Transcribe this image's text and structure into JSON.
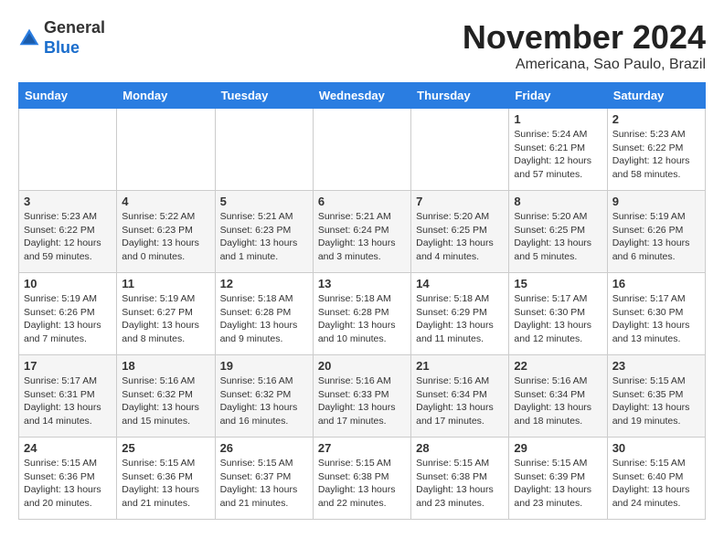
{
  "header": {
    "logo_general": "General",
    "logo_blue": "Blue",
    "month_title": "November 2024",
    "subtitle": "Americana, Sao Paulo, Brazil"
  },
  "weekdays": [
    "Sunday",
    "Monday",
    "Tuesday",
    "Wednesday",
    "Thursday",
    "Friday",
    "Saturday"
  ],
  "weeks": [
    [
      {
        "day": "",
        "info": ""
      },
      {
        "day": "",
        "info": ""
      },
      {
        "day": "",
        "info": ""
      },
      {
        "day": "",
        "info": ""
      },
      {
        "day": "",
        "info": ""
      },
      {
        "day": "1",
        "info": "Sunrise: 5:24 AM\nSunset: 6:21 PM\nDaylight: 12 hours\nand 57 minutes."
      },
      {
        "day": "2",
        "info": "Sunrise: 5:23 AM\nSunset: 6:22 PM\nDaylight: 12 hours\nand 58 minutes."
      }
    ],
    [
      {
        "day": "3",
        "info": "Sunrise: 5:23 AM\nSunset: 6:22 PM\nDaylight: 12 hours\nand 59 minutes."
      },
      {
        "day": "4",
        "info": "Sunrise: 5:22 AM\nSunset: 6:23 PM\nDaylight: 13 hours\nand 0 minutes."
      },
      {
        "day": "5",
        "info": "Sunrise: 5:21 AM\nSunset: 6:23 PM\nDaylight: 13 hours\nand 1 minute."
      },
      {
        "day": "6",
        "info": "Sunrise: 5:21 AM\nSunset: 6:24 PM\nDaylight: 13 hours\nand 3 minutes."
      },
      {
        "day": "7",
        "info": "Sunrise: 5:20 AM\nSunset: 6:25 PM\nDaylight: 13 hours\nand 4 minutes."
      },
      {
        "day": "8",
        "info": "Sunrise: 5:20 AM\nSunset: 6:25 PM\nDaylight: 13 hours\nand 5 minutes."
      },
      {
        "day": "9",
        "info": "Sunrise: 5:19 AM\nSunset: 6:26 PM\nDaylight: 13 hours\nand 6 minutes."
      }
    ],
    [
      {
        "day": "10",
        "info": "Sunrise: 5:19 AM\nSunset: 6:26 PM\nDaylight: 13 hours\nand 7 minutes."
      },
      {
        "day": "11",
        "info": "Sunrise: 5:19 AM\nSunset: 6:27 PM\nDaylight: 13 hours\nand 8 minutes."
      },
      {
        "day": "12",
        "info": "Sunrise: 5:18 AM\nSunset: 6:28 PM\nDaylight: 13 hours\nand 9 minutes."
      },
      {
        "day": "13",
        "info": "Sunrise: 5:18 AM\nSunset: 6:28 PM\nDaylight: 13 hours\nand 10 minutes."
      },
      {
        "day": "14",
        "info": "Sunrise: 5:18 AM\nSunset: 6:29 PM\nDaylight: 13 hours\nand 11 minutes."
      },
      {
        "day": "15",
        "info": "Sunrise: 5:17 AM\nSunset: 6:30 PM\nDaylight: 13 hours\nand 12 minutes."
      },
      {
        "day": "16",
        "info": "Sunrise: 5:17 AM\nSunset: 6:30 PM\nDaylight: 13 hours\nand 13 minutes."
      }
    ],
    [
      {
        "day": "17",
        "info": "Sunrise: 5:17 AM\nSunset: 6:31 PM\nDaylight: 13 hours\nand 14 minutes."
      },
      {
        "day": "18",
        "info": "Sunrise: 5:16 AM\nSunset: 6:32 PM\nDaylight: 13 hours\nand 15 minutes."
      },
      {
        "day": "19",
        "info": "Sunrise: 5:16 AM\nSunset: 6:32 PM\nDaylight: 13 hours\nand 16 minutes."
      },
      {
        "day": "20",
        "info": "Sunrise: 5:16 AM\nSunset: 6:33 PM\nDaylight: 13 hours\nand 17 minutes."
      },
      {
        "day": "21",
        "info": "Sunrise: 5:16 AM\nSunset: 6:34 PM\nDaylight: 13 hours\nand 17 minutes."
      },
      {
        "day": "22",
        "info": "Sunrise: 5:16 AM\nSunset: 6:34 PM\nDaylight: 13 hours\nand 18 minutes."
      },
      {
        "day": "23",
        "info": "Sunrise: 5:15 AM\nSunset: 6:35 PM\nDaylight: 13 hours\nand 19 minutes."
      }
    ],
    [
      {
        "day": "24",
        "info": "Sunrise: 5:15 AM\nSunset: 6:36 PM\nDaylight: 13 hours\nand 20 minutes."
      },
      {
        "day": "25",
        "info": "Sunrise: 5:15 AM\nSunset: 6:36 PM\nDaylight: 13 hours\nand 21 minutes."
      },
      {
        "day": "26",
        "info": "Sunrise: 5:15 AM\nSunset: 6:37 PM\nDaylight: 13 hours\nand 21 minutes."
      },
      {
        "day": "27",
        "info": "Sunrise: 5:15 AM\nSunset: 6:38 PM\nDaylight: 13 hours\nand 22 minutes."
      },
      {
        "day": "28",
        "info": "Sunrise: 5:15 AM\nSunset: 6:38 PM\nDaylight: 13 hours\nand 23 minutes."
      },
      {
        "day": "29",
        "info": "Sunrise: 5:15 AM\nSunset: 6:39 PM\nDaylight: 13 hours\nand 23 minutes."
      },
      {
        "day": "30",
        "info": "Sunrise: 5:15 AM\nSunset: 6:40 PM\nDaylight: 13 hours\nand 24 minutes."
      }
    ]
  ]
}
